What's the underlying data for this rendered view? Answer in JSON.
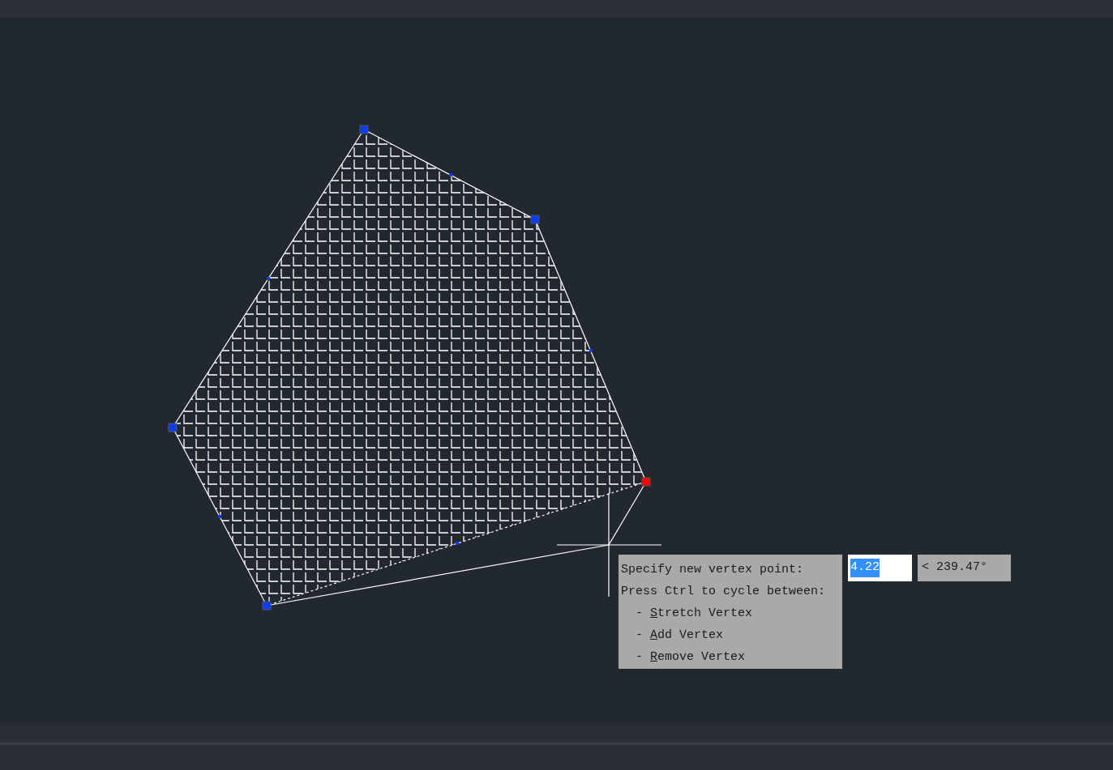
{
  "drawing": {
    "vertices": [
      {
        "selected": false
      },
      {
        "selected": false
      },
      {
        "selected": true
      },
      {
        "selected": false
      },
      {
        "selected": false
      }
    ]
  },
  "tooltip": {
    "lines": [
      "Specify new vertex point:",
      "Press Ctrl to cycle between:"
    ],
    "options": [
      {
        "dash": "-",
        "label": "Stretch Vertex"
      },
      {
        "dash": "-",
        "label": "Add Vertex"
      },
      {
        "dash": "-",
        "label": "Remove Vertex"
      }
    ]
  },
  "distance_input": {
    "value": "4.22",
    "selected": true
  },
  "angle_input": {
    "value": "< 239.47°"
  }
}
